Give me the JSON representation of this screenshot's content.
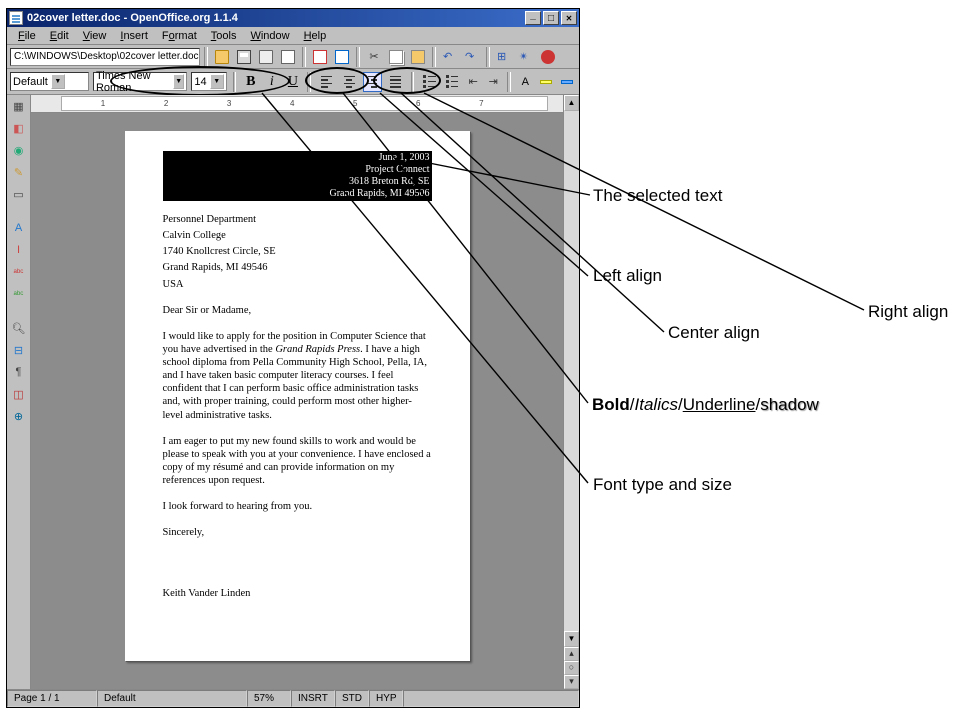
{
  "window": {
    "title": "02cover letter.doc - OpenOffice.org 1.1.4",
    "file_path": "C:\\WINDOWS\\Desktop\\02cover letter.doc"
  },
  "menu": {
    "file": "File",
    "edit": "Edit",
    "view": "View",
    "insert": "Insert",
    "format": "Format",
    "tools": "Tools",
    "window": "Window",
    "help": "Help"
  },
  "format_bar": {
    "style": "Default",
    "font": "Times New Roman",
    "size": "14",
    "bold": "B",
    "italic": "i",
    "underline": "U"
  },
  "ruler": {
    "t1": "1",
    "t2": "2",
    "t3": "3",
    "t4": "4",
    "t5": "5",
    "t6": "6",
    "t7": "7"
  },
  "letter": {
    "sender_date": "June 1, 2003",
    "sender_org": "Project Connect",
    "sender_addr1": "3618 Breton Rd, SE",
    "sender_addr2": "Grand Rapids, MI 49506",
    "recip_l1": "Personnel Department",
    "recip_l2": "Calvin College",
    "recip_l3": "1740 Knollcrest Circle, SE",
    "recip_l4": "Grand Rapids, MI 49546",
    "recip_l5": "USA",
    "salutation": "Dear Sir or Madame,",
    "body1a": "I would like to apply for the position in Computer Science that you have advertised in the ",
    "body1_ital": "Grand Rapids Press",
    "body1b": ". I have a high school diploma from Pella Community High School, Pella, IA, and I have taken basic computer literacy courses. I feel confident that I can perform basic office administration tasks and, with proper training, could perform most other higher-level administrative tasks.",
    "body2": "I am eager to put my new found skills to work and would be please to speak with you at your convenience. I have enclosed a copy of my résumé and can provide information on my references upon request.",
    "closing1": "I look forward to hearing from you.",
    "closing2": "Sincerely,",
    "signature": "Keith Vander Linden"
  },
  "status": {
    "page": "Page 1 / 1",
    "style": "Default",
    "zoom": "57%",
    "insrt": "INSRT",
    "std": "STD",
    "hyp": "HYP"
  },
  "annotations": {
    "selected": "The selected text",
    "left": "Left align",
    "center": "Center align",
    "right": "Right align",
    "biu_bold": "Bold",
    "biu_sep": "/",
    "biu_ital": "Italics",
    "biu_under": "Underline",
    "biu_shadow": "shadow",
    "fontsize": "Font type and size"
  }
}
